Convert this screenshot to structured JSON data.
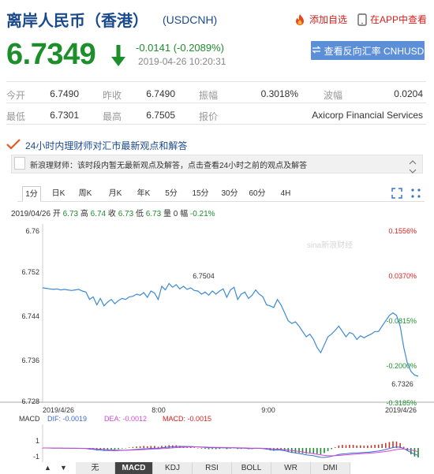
{
  "header": {
    "title": "离岸人民币（香港）",
    "symbol": "(USDCNH)",
    "add_watch": "添加自选",
    "app_view": "在APP中查看"
  },
  "quote": {
    "price": "6.7349",
    "change": "-0.0141 (-0.2089%)",
    "timestamp": "2019-04-26 10:20:31",
    "reverse_button": "查看反向汇率 CNHUSD"
  },
  "stats": {
    "open_label": "今开",
    "open": "6.7490",
    "prev_close_label": "昨收",
    "prev_close": "6.7490",
    "amplitude_label": "振幅",
    "amplitude": "0.3018%",
    "volatility_label": "波幅",
    "volatility": "0.0204",
    "low_label": "最低",
    "low": "6.7301",
    "high_label": "最高",
    "high": "6.7505",
    "quote_label": "报价",
    "quote_source": "Axicorp Financial Services"
  },
  "news": {
    "heading": "24小时内理财师对汇市最新观点和解答",
    "text": "新浪理财师：该时段内暂无最新观点及解答，点击查看24小时之前的观点及解答"
  },
  "tabs": [
    "1分",
    "日K",
    "周K",
    "月K",
    "年K",
    "5分",
    "15分",
    "30分",
    "60分",
    "4H"
  ],
  "info_line": {
    "date": "2019/04/26",
    "open_label": "开",
    "open": "6.73",
    "high_label": "高",
    "high": "6.74",
    "close_label": "收",
    "close": "6.73",
    "low_label": "低",
    "low": "6.73",
    "volume_label": "量",
    "volume": "0",
    "range_label": "幅",
    "range": "-0.21%"
  },
  "chart_data": {
    "type": "line",
    "watermark": "sina新浪财经",
    "y_ticks": [
      "6.76",
      "6.752",
      "6.744",
      "6.736",
      "6.728"
    ],
    "y_tick_values": [
      6.76,
      6.752,
      6.744,
      6.736,
      6.728
    ],
    "pct_ticks": [
      "0.1556%",
      "0.0370%",
      "-0.0815%",
      "-0.2000%",
      "-0.3185%"
    ],
    "x_ticks": [
      "2019/4/26",
      "8:00",
      "9:00",
      "2019/4/26"
    ],
    "ylim": [
      6.728,
      6.76
    ],
    "annotation_high": "6.7504",
    "annotation_last": "6.7326",
    "series": [
      {
        "values": [
          6.7492,
          6.7491,
          6.749,
          6.7489,
          6.749,
          6.7488,
          6.7489,
          6.7488,
          6.7487,
          6.7488,
          6.7489,
          6.7486,
          6.7484,
          6.747,
          6.7475,
          6.746,
          6.7472,
          6.7458,
          6.7465,
          6.747,
          6.7462,
          6.7468,
          6.7472,
          6.747,
          6.7475,
          6.7476,
          6.748,
          6.7478,
          6.7483,
          6.7474,
          6.7486,
          6.7482,
          6.747,
          6.7495,
          6.7488,
          6.75,
          6.7493,
          6.7498,
          6.749,
          6.7495,
          6.7489,
          6.7492,
          6.7487,
          6.7486,
          6.748,
          6.7484,
          6.7478,
          6.7486,
          6.748,
          6.7486,
          6.749,
          6.7474,
          6.7488,
          6.7493,
          6.747,
          6.748,
          6.7484,
          6.7472,
          6.7478,
          6.7488,
          6.748,
          6.7475,
          6.746,
          6.7458,
          6.7455,
          6.747,
          6.746,
          6.7445,
          6.743,
          6.7425,
          6.7428,
          6.742,
          6.741,
          6.74,
          6.7405,
          6.7395,
          6.738,
          6.737,
          6.7385,
          6.74,
          6.7405,
          6.7412,
          6.742,
          6.741,
          6.74,
          6.7408,
          6.7405,
          6.7395,
          6.7402,
          6.7398,
          6.7402,
          6.7405,
          6.741,
          6.741,
          6.742,
          6.743,
          6.744,
          6.7445,
          6.744,
          6.742,
          6.738,
          6.735,
          6.7335,
          6.7328,
          6.7326
        ]
      }
    ]
  },
  "macd": {
    "label": "MACD",
    "dif": "DIF: -0.0019",
    "dea": "DEA: -0.0012",
    "macd": "MACD: -0.0015",
    "y_ticks": [
      "1",
      "-1"
    ]
  },
  "indicator_tabs": [
    "无",
    "MACD",
    "KDJ",
    "RSI",
    "BOLL",
    "WR",
    "DMI"
  ],
  "colors": {
    "title": "#1a4a8c",
    "up": "#d8201d",
    "down": "#1c8e2a",
    "line": "#3c8bd4",
    "button": "#5d8fd8"
  }
}
